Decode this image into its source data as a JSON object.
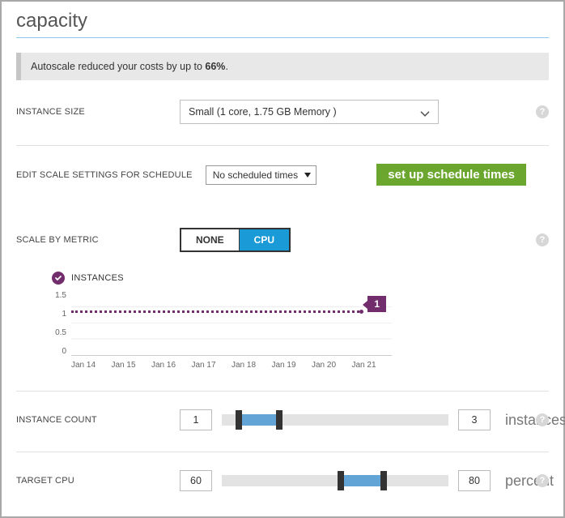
{
  "title": "capacity",
  "banner": {
    "prefix": "Autoscale reduced your costs by up to ",
    "pct": "66%",
    "suffix": "."
  },
  "instance_size": {
    "label": "INSTANCE SIZE",
    "value": "Small (1 core, 1.75 GB Memory )"
  },
  "schedule": {
    "label": "EDIT SCALE SETTINGS FOR SCHEDULE",
    "value": "No scheduled times",
    "button": "set up schedule times"
  },
  "metric": {
    "label": "SCALE BY METRIC",
    "options": [
      "NONE",
      "CPU"
    ],
    "selected": "CPU"
  },
  "chart_data": {
    "type": "line",
    "title": "INSTANCES",
    "categories": [
      "Jan 14",
      "Jan 15",
      "Jan 16",
      "Jan 17",
      "Jan 18",
      "Jan 19",
      "Jan 20",
      "Jan 21"
    ],
    "series": [
      {
        "name": "Instances",
        "values": [
          1,
          1,
          1,
          1,
          1,
          1,
          1,
          1
        ]
      }
    ],
    "badge_value": "1",
    "ylim": [
      0,
      1.5
    ],
    "yticks": [
      "1.5",
      "1",
      "0.5",
      "0"
    ]
  },
  "instance_count": {
    "label": "INSTANCE COUNT",
    "min": "1",
    "max": "3",
    "unit": "instances",
    "low_pct": 6,
    "high_pct": 24
  },
  "target_cpu": {
    "label": "TARGET CPU",
    "min": "60",
    "max": "80",
    "unit": "percent",
    "low_pct": 51,
    "high_pct": 70
  }
}
